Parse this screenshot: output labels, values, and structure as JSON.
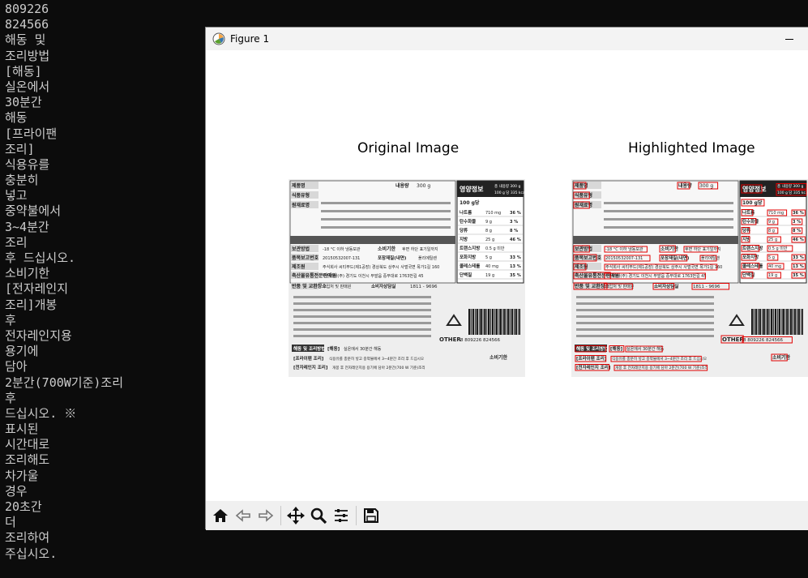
{
  "terminal": {
    "lines": [
      "809226",
      "824566",
      "해동 및",
      "조리방법",
      "[해동]",
      "실온에서",
      "30분간",
      "해동",
      "[프라이팬",
      "조리]",
      "식용유를",
      "충분히",
      "넣고",
      "중약불에서",
      "3~4분간",
      "조리",
      "후 드십시오.",
      "소비기한",
      "[전자레인지",
      "조리]개봉",
      "후",
      "전자레인지용",
      "용기에",
      "담아",
      "2분간(700W기준)조리",
      "후",
      "드십시오. ※",
      "표시된",
      "시간대로",
      "조리해도",
      "차가울",
      "경우",
      "20초간",
      "더",
      "조리하여",
      "주십시오."
    ]
  },
  "window": {
    "title": "Figure 1",
    "toolbar": [
      "home-icon",
      "back-icon",
      "forward-icon",
      "pan-icon",
      "zoom-icon",
      "configure-icon",
      "save-icon"
    ]
  },
  "figure": {
    "left_title": "Original Image",
    "right_title": "Highlighted Image",
    "label": {
      "product_label_1": "제품명",
      "food_type_label": "식품유형",
      "raw_material_label": "원재료명",
      "content_label": "내용량",
      "content_value": "300 g",
      "nutrition_title": "영양정보",
      "nutrition_total": "총 내용량 300 g",
      "nutrition_per": "100 g 당 335 kcal",
      "nutrition_serving": "100 g당",
      "nutrients": [
        {
          "name": "나트륨",
          "amount": "710 mg",
          "pct": "36 %"
        },
        {
          "name": "탄수화물",
          "amount": "9 g",
          "pct": "3 %"
        },
        {
          "name": "당류",
          "amount": "8 g",
          "pct": "8 %"
        },
        {
          "name": "지방",
          "amount": "25 g",
          "pct": "46 %"
        },
        {
          "name": "트랜스지방",
          "amount": "0.5 g 미만",
          "pct": ""
        },
        {
          "name": "포화지방",
          "amount": "5 g",
          "pct": "33 %"
        },
        {
          "name": "콜레스테롤",
          "amount": "40 mg",
          "pct": "13 %"
        },
        {
          "name": "단백질",
          "amount": "19 g",
          "pct": "35 %"
        }
      ],
      "storage_label": "보관방법",
      "storage_value": "-18 °C 이하 냉동보관",
      "expiry_label": "소비기한",
      "expiry_value": "후면 하단 표기일까지",
      "report_no_label": "품목보고번호",
      "report_no_value": "20150532007-131",
      "packaging_label": "포장재질(내면)",
      "packaging_value": "폴리에틸렌",
      "maker_label": "제조원",
      "maker_value": "주식회사 씨티푸드(제1공장) 경상북도 상주시 사벌국면 목가1길 160",
      "seller_label": "축산물유통전문판매원",
      "seller_value": "두산스타(주) 경기도 이천시 부발읍 중부대로 1763번길 45",
      "return_label": "반품 및 교환장소",
      "return_value": "구입처 및 판매원",
      "consult_label": "소비자상담실",
      "consult_value": "1811 - 9696",
      "recycle_label": "OTHER",
      "barcode_text": "8 809226 824566",
      "thaw_label": "해동 및 조리방법",
      "thaw_tag": "[해동]",
      "thaw_text": "실온에서 30분간 해동",
      "pan_tag": "[프라이팬 조리]",
      "pan_text": "식용유를 충분히 넣고 중약불에서 3~4분간 조리 후 드십시오",
      "mw_tag": "[전자레인지 조리]",
      "mw_text": "개봉 후 전자레인지용 용기에 담아 2분간(700 W 기준)조리",
      "expiry_small": "소비기한"
    }
  },
  "colors": {
    "terminal_bg": "#0c0c0c",
    "terminal_fg": "#cccccc",
    "highlight": "#e00000"
  }
}
